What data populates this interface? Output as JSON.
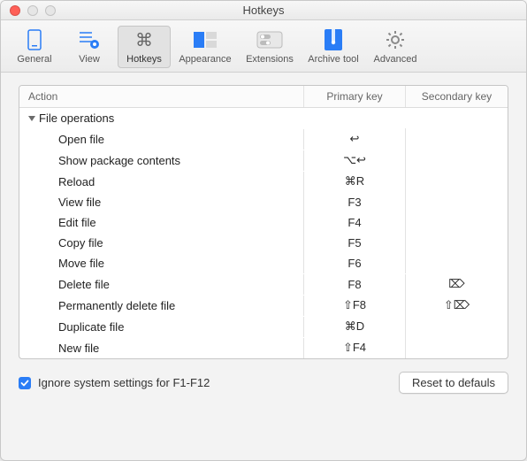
{
  "title": "Hotkeys",
  "toolbar": {
    "items": [
      {
        "id": "general",
        "label": "General"
      },
      {
        "id": "view",
        "label": "View"
      },
      {
        "id": "hotkeys",
        "label": "Hotkeys"
      },
      {
        "id": "appearance",
        "label": "Appearance"
      },
      {
        "id": "extensions",
        "label": "Extensions"
      },
      {
        "id": "archivetool",
        "label": "Archive tool"
      },
      {
        "id": "advanced",
        "label": "Advanced"
      }
    ],
    "active": "hotkeys"
  },
  "columns": {
    "action": "Action",
    "primary": "Primary key",
    "secondary": "Secondary key"
  },
  "group_label": "File operations",
  "rows": [
    {
      "action": "Open file",
      "primary": "↩",
      "secondary": ""
    },
    {
      "action": "Show package contents",
      "primary": "⌥↩",
      "secondary": ""
    },
    {
      "action": "Reload",
      "primary": "⌘R",
      "secondary": ""
    },
    {
      "action": "View file",
      "primary": "F3",
      "secondary": ""
    },
    {
      "action": "Edit file",
      "primary": "F4",
      "secondary": ""
    },
    {
      "action": "Copy file",
      "primary": "F5",
      "secondary": ""
    },
    {
      "action": "Move file",
      "primary": "F6",
      "secondary": ""
    },
    {
      "action": "Delete file",
      "primary": "F8",
      "secondary": "⌦"
    },
    {
      "action": "Permanently delete file",
      "primary": "⇧F8",
      "secondary": "⇧⌦"
    },
    {
      "action": "Duplicate file",
      "primary": "⌘D",
      "secondary": ""
    },
    {
      "action": "New file",
      "primary": "⇧F4",
      "secondary": ""
    }
  ],
  "footer": {
    "checkbox_label": "Ignore system settings for F1-F12",
    "checkbox_checked": true,
    "reset_label": "Reset to defauls"
  },
  "colors": {
    "accent": "#2a7df6"
  }
}
